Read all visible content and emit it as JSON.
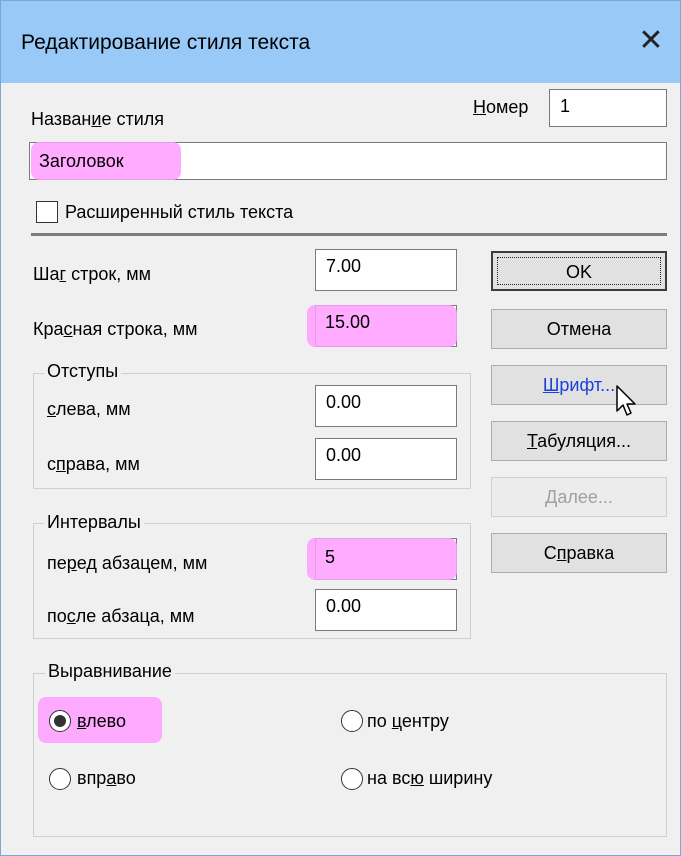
{
  "window": {
    "title": "Редактирование стиля текста",
    "close_icon": "close-icon"
  },
  "style_name": {
    "label_pre": "Назван",
    "label_ul": "и",
    "label_post": "е стиля",
    "value": "Заголовок"
  },
  "number": {
    "label_ul": "Н",
    "label_post": "омер",
    "value": "1"
  },
  "extended": {
    "label": "Расширенный стиль текста",
    "checked": false
  },
  "line_step": {
    "label_pre": "Ша",
    "label_ul": "г",
    "label_post": " строк, мм",
    "value": "7.00"
  },
  "red_line": {
    "label_pre": "Кра",
    "label_ul": "с",
    "label_post": "ная строка, мм",
    "value": "15.00"
  },
  "indents": {
    "title": "Отступы",
    "left": {
      "label_ul": "с",
      "label_post": "лева, мм",
      "value": "0.00"
    },
    "right": {
      "label_pre": "с",
      "label_ul": "п",
      "label_post": "рава, мм",
      "value": "0.00"
    }
  },
  "intervals": {
    "title": "Интервалы",
    "before": {
      "label_pre": "пе",
      "label_ul": "р",
      "label_post": "ед абзацем, мм",
      "value": "5"
    },
    "after": {
      "label_pre": "по",
      "label_ul": "с",
      "label_post": "ле абзаца, мм",
      "value": "0.00"
    }
  },
  "buttons": {
    "ok": "OK",
    "cancel": "Отмена",
    "font": {
      "ul": "Ш",
      "post": "рифт..."
    },
    "tab": {
      "ul": "Т",
      "post": "абуляция..."
    },
    "next": {
      "ul": "Д",
      "post": "алее..."
    },
    "help": {
      "pre": "С",
      "ul": "п",
      "post": "равка"
    }
  },
  "alignment": {
    "title": "Выравнивание",
    "left": {
      "ul": "в",
      "post": "лево",
      "selected": true
    },
    "center": {
      "pre": "по ",
      "ul": "ц",
      "post": "ентру",
      "selected": false
    },
    "right": {
      "pre": "впр",
      "ul": "а",
      "post": "во",
      "selected": false
    },
    "justify": {
      "pre": "на вс",
      "ul": "ю",
      "post": " ширину",
      "selected": false
    }
  },
  "colors": {
    "titlebar": "#99c9f6",
    "highlight": "#ff9cff",
    "link": "#1b3fe0"
  }
}
